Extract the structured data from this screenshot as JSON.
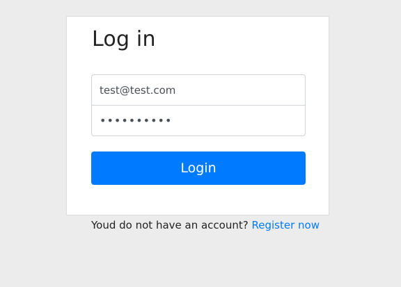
{
  "page": {
    "background": "#ececec"
  },
  "card": {
    "title": "Log in"
  },
  "form": {
    "email_value": "test@test.com",
    "password_value": "••••••••••",
    "login_label": "Login"
  },
  "footer": {
    "prompt_text": "Youd do not have an account?",
    "register_label": "Register now"
  },
  "colors": {
    "accent": "#007bff",
    "card_background": "#ffffff",
    "text": "#222222"
  }
}
